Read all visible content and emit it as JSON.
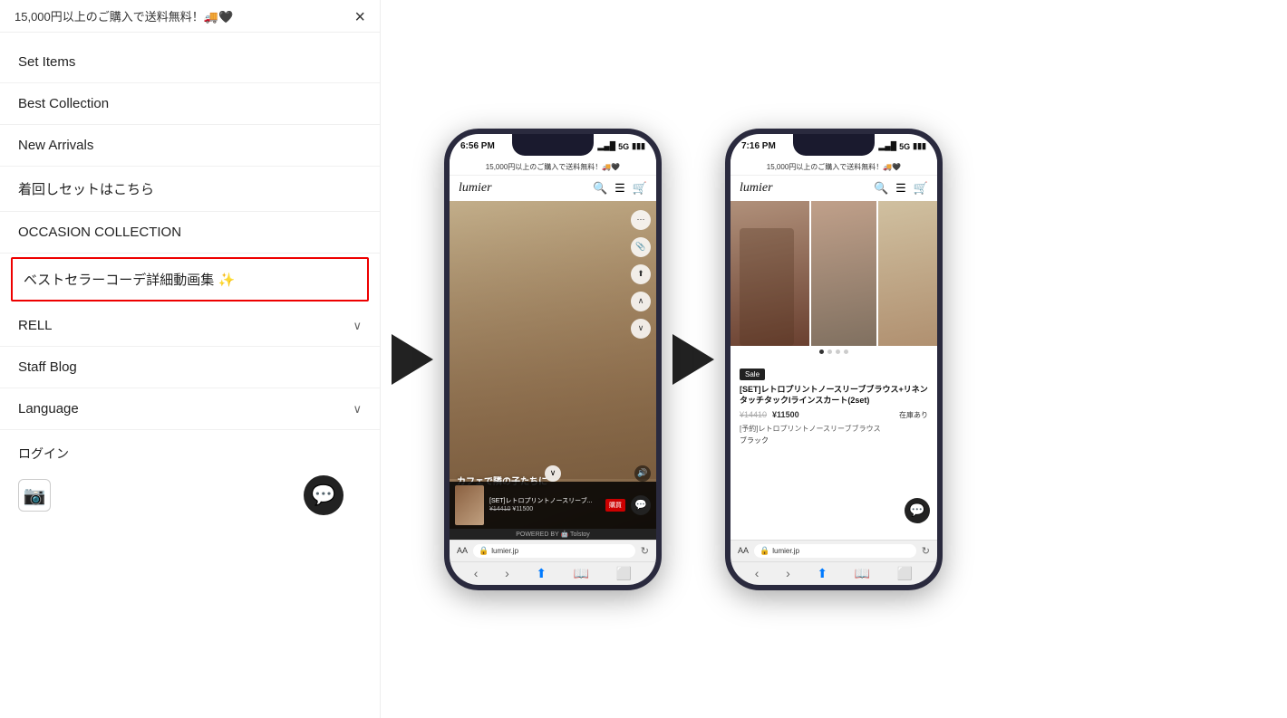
{
  "announcement": "15,000円以上のご購入で送料無料！🚚🖤",
  "menu": {
    "items": [
      {
        "label": "Set Items",
        "hasChevron": false
      },
      {
        "label": "Best Collection",
        "hasChevron": false
      },
      {
        "label": "New Arrivals",
        "hasChevron": false
      },
      {
        "label": "着回しセットはこちら",
        "hasChevron": false
      },
      {
        "label": "OCCASION COLLECTION",
        "hasChevron": false
      },
      {
        "label": "ベストセラーコーデ詳細動画集 ✨",
        "hasChevron": false,
        "highlighted": true
      },
      {
        "label": "RELL",
        "hasChevron": true
      },
      {
        "label": "Staff Blog",
        "hasChevron": false
      },
      {
        "label": "Language",
        "hasChevron": true
      }
    ],
    "login_label": "ログイン"
  },
  "phone1": {
    "time": "6:56 PM",
    "network": "5G",
    "announcement": "15,000円以上のご購入で送料無料！🚚🖤",
    "logo": "lumier",
    "hero_text": "カフェで隣の子たちに",
    "product_name": "[SET]レトロプリントノースリーブ...",
    "price_old": "¥14410",
    "price_new": "¥11500",
    "url": "lumier.jp",
    "powered_by": "POWERED BY 🤖 Tolstoy"
  },
  "phone2": {
    "time": "7:16 PM",
    "network": "5G",
    "announcement": "15,000円以上のご購入で送料無料！🚚🖤",
    "logo": "lumier",
    "sale_badge": "Sale",
    "product_title": "[SET]レトロプリントノースリーブブラウス+リネンタッチタックIラインスカート(2set)",
    "price_old": "¥14410",
    "price_new": "¥11500",
    "stock": "在庫あり",
    "variant_label": "[予約]レトロプリントノースリーブブラウス",
    "color": "ブラック",
    "url": "lumier.jp"
  },
  "icons": {
    "close": "×",
    "chevron_down": "∨",
    "search": "🔍",
    "menu_ham": "☰",
    "cart": "🛒",
    "chat": "💬",
    "instagram": "📷",
    "share": "⬆",
    "bookmark": "📖",
    "tab": "⬜",
    "back": "‹",
    "forward": "›",
    "reload": "↻",
    "lock": "🔒",
    "signal": "▂▄█",
    "battery": "▮",
    "more": "⋯",
    "save": "📎",
    "volume": "🔊",
    "up": "∧",
    "down": "∨"
  }
}
